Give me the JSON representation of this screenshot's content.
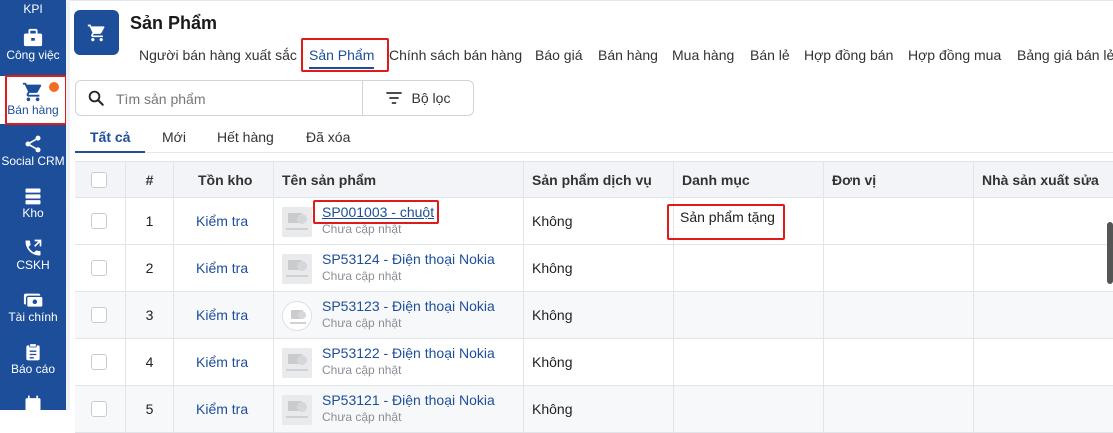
{
  "sidebar": {
    "items": [
      {
        "label": "KPI",
        "icon": "kpi-icon"
      },
      {
        "label": "Công việc",
        "icon": "briefcase-icon"
      },
      {
        "label": "Bán hàng",
        "icon": "cart-icon",
        "active": true
      },
      {
        "label": "Social CRM",
        "icon": "share-icon"
      },
      {
        "label": "Kho",
        "icon": "warehouse-icon"
      },
      {
        "label": "CSKH",
        "icon": "phone-icon"
      },
      {
        "label": "Tài chính",
        "icon": "money-icon"
      },
      {
        "label": "Báo cáo",
        "icon": "clipboard-icon"
      }
    ]
  },
  "header": {
    "title": "Sản Phẩm",
    "icon": "cart-icon"
  },
  "nav_tabs": [
    "Người bán hàng xuất sắc",
    "Sản Phẩm",
    "Chính sách bán hàng",
    "Báo giá",
    "Bán hàng",
    "Mua hàng",
    "Bán lẻ",
    "Hợp đồng bán",
    "Hợp đồng mua",
    "Bảng giá bán lẻ"
  ],
  "search": {
    "placeholder": "Tìm sản phẩm",
    "filter_label": "Bộ lọc"
  },
  "sub_tabs": [
    "Tất cả",
    "Mới",
    "Hết hàng",
    "Đã xóa"
  ],
  "table": {
    "columns": [
      "#",
      "Tồn kho",
      "Tên sản phẩm",
      "Sản phẩm dịch vụ",
      "Danh mục",
      "Đơn vị",
      "Nhà sản xuất sửa"
    ],
    "rows": [
      {
        "index": "1",
        "stock": "Kiểm tra",
        "name": "SP001003 - chuột",
        "sub": "Chưa cập nhật",
        "service": "Không",
        "category": "Sản phẩm tặng",
        "unit": "",
        "maker": ""
      },
      {
        "index": "2",
        "stock": "Kiểm tra",
        "name": "SP53124 - Điện thoại Nokia",
        "sub": "Chưa cập nhật",
        "service": "Không",
        "category": "",
        "unit": "",
        "maker": ""
      },
      {
        "index": "3",
        "stock": "Kiểm tra",
        "name": "SP53123 - Điện thoại Nokia",
        "sub": "Chưa cập nhật",
        "service": "Không",
        "category": "",
        "unit": "",
        "maker": ""
      },
      {
        "index": "4",
        "stock": "Kiểm tra",
        "name": "SP53122 - Điện thoại Nokia",
        "sub": "Chưa cập nhật",
        "service": "Không",
        "category": "",
        "unit": "",
        "maker": ""
      },
      {
        "index": "5",
        "stock": "Kiểm tra",
        "name": "SP53121 - Điện thoại Nokia",
        "sub": "Chưa cập nhật",
        "service": "Không",
        "category": "",
        "unit": "",
        "maker": ""
      }
    ]
  },
  "colors": {
    "brand": "#1d4e9a",
    "highlight": "#e0191b",
    "badge": "#f36c21"
  }
}
